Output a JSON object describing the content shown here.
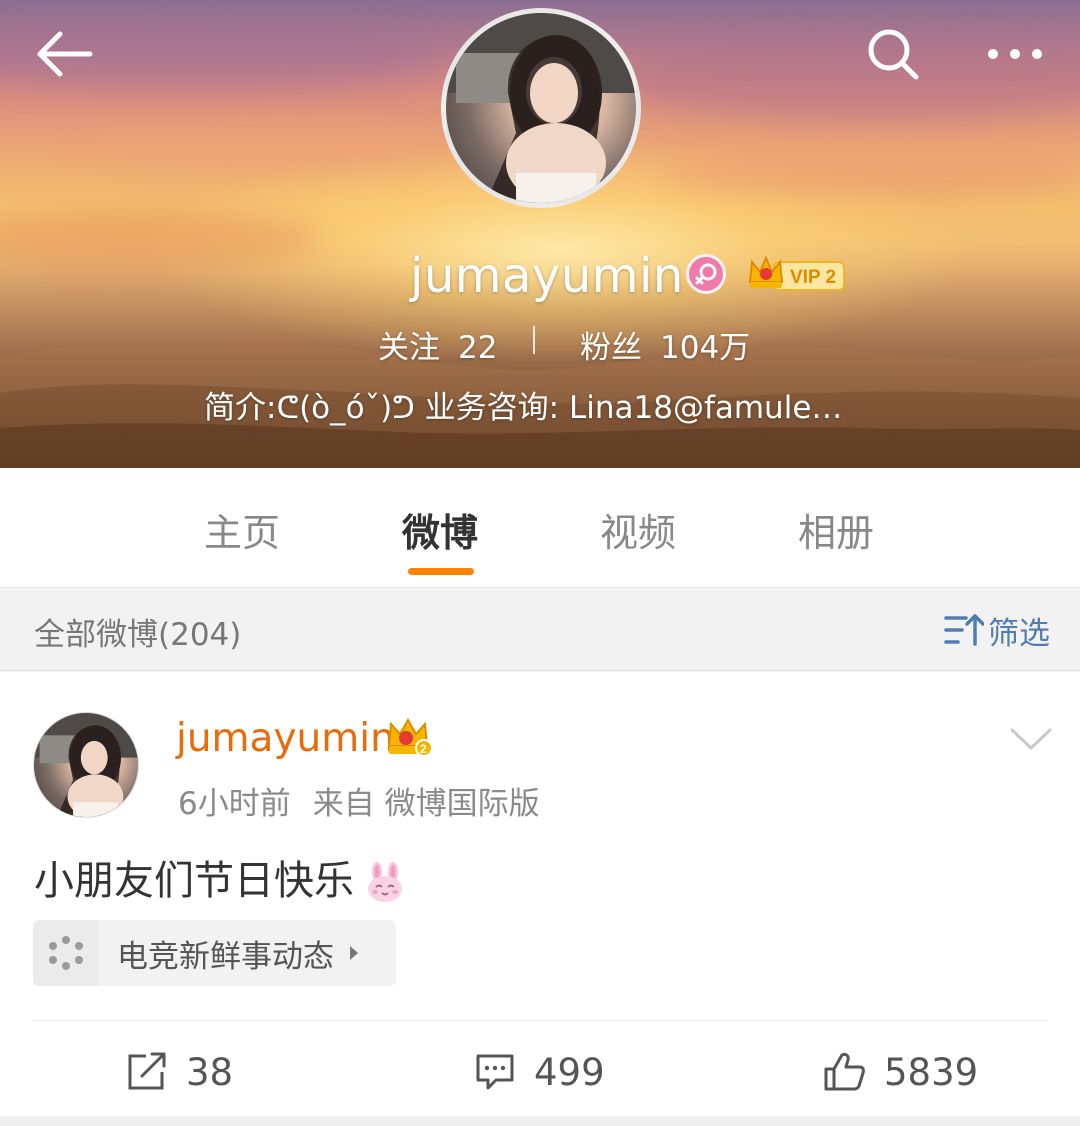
{
  "profile": {
    "username": "jumayumin",
    "vip_label": "VIP 2",
    "follow_label": "关注",
    "follow_count": "22",
    "fans_label": "粉丝",
    "fans_count": "104万",
    "bio": "简介:ᕦ(ò_óˇ)ᕤ  业务咨询: Lina18@famule…"
  },
  "tabs": [
    {
      "label": "主页"
    },
    {
      "label": "微博"
    },
    {
      "label": "视频"
    },
    {
      "label": "相册"
    }
  ],
  "active_tab": "微博",
  "feed": {
    "all_label": "全部微博(204)",
    "filter_label": "筛选"
  },
  "post": {
    "username": "jumayumin",
    "time": "6小时前",
    "source": "来自 微博国际版",
    "text": "小朋友们节日快乐",
    "topic": "电竞新鲜事动态",
    "reposts": "38",
    "comments": "499",
    "likes": "5839"
  },
  "colors": {
    "accent_orange": "#ff8200",
    "username_orange": "#e86b0c",
    "link_blue": "#507daf",
    "female_pink": "#f07aa8"
  },
  "icons": [
    "back-arrow-icon",
    "search-icon",
    "more-icon",
    "female-icon",
    "vip-crown-icon",
    "filter-icon",
    "chevron-down-icon",
    "bunny-emoji-icon",
    "topic-dots-icon",
    "repost-icon",
    "comment-icon",
    "like-icon"
  ]
}
